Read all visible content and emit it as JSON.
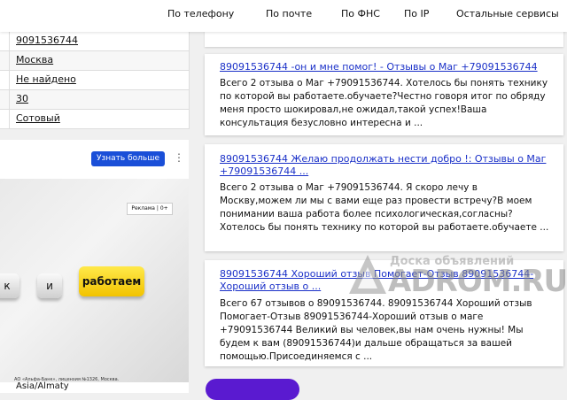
{
  "nav": {
    "items": [
      "По телефону",
      "По почте",
      "По ФНС",
      "По IP",
      "Остальные сервисы"
    ]
  },
  "info_table": {
    "values": [
      "9091536744",
      "Москва",
      "Не найдено",
      "30",
      "Сотовый"
    ]
  },
  "ad": {
    "button_label": "Узнать больше",
    "menu_icon": "more-vertical-icon",
    "badge": "Реклама | 0+",
    "keys": [
      "к",
      "и",
      "работаем"
    ],
    "fine_print": "АО «Альфа-Банк», лицензия №1326, Москва.",
    "footer_text": "Asia/Almaty"
  },
  "results": [
    {
      "title": "89091536744 -он и мне помог! - Отзывы о Маг +79091536744",
      "text": "Всего 2 отзыва о Маг +79091536744. Хотелось бы понять технику по которой вы работаете.обучаете?Честно говоря итог по обряду меня просто шокировал,не ожидал,такой успех!Ваша консультация безусловно интересна и ..."
    },
    {
      "title": "89091536744 Желаю продолжать нести добро !: Отзывы о Маг +79091536744 ...",
      "text": "Всего 2 отзыва о Маг +79091536744. Я скоро лечу в Москву,можем ли мы с вами еще раз провести встречу?В моем понимании ваша работа более психологическая,согласны?Хотелось бы понять технику по которой вы работаете.обучаете ..."
    },
    {
      "title": "89091536744 Хороший отзыв Помогает-Отзыв 89091536744-Хороший отзыв о ...",
      "text": "Всего 67 отзывов о 89091536744. 89091536744 Хороший отзыв Помогает-Отзыв 89091536744-Хороший отзыв о маге +79091536744 Великий вы человек,вы нам очень нужны! Мы будем к вам (89091536744)и дальше обращаться за вашей помощью.Присоединяемся с ..."
    }
  ],
  "watermark": {
    "top": "Доска объявлений",
    "main": "ADROM.RU"
  },
  "colors": {
    "link": "#1a30c8",
    "ad_button": "#1a4fd8",
    "accent_purple": "#5a1ad0",
    "key_yellow": "#f2c300"
  }
}
